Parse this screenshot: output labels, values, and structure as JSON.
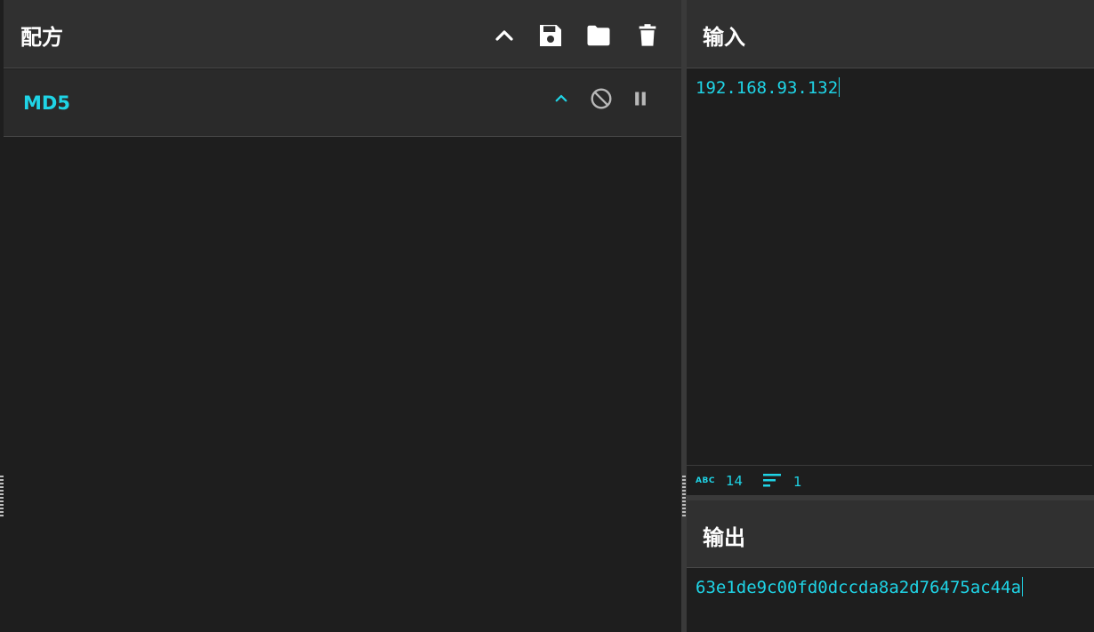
{
  "recipe": {
    "title": "配方",
    "toolbar": {
      "collapse_icon": "chevron-up-icon",
      "save_icon": "save-icon",
      "load_icon": "folder-icon",
      "clear_icon": "trash-icon"
    },
    "operations": [
      {
        "name": "MD5",
        "icons": [
          "chevron-up-icon",
          "disable-icon",
          "pause-icon"
        ]
      }
    ]
  },
  "input": {
    "title": "输入",
    "value": "192.168.93.132",
    "stats": {
      "length_label": "14",
      "lines_label": "1"
    }
  },
  "output": {
    "title": "输出",
    "value": "63e1de9c00fd0dccda8a2d76475ac44a"
  },
  "colors": {
    "accent": "#1fd4e6",
    "header_bg": "#303030",
    "pane_bg": "#1e1e1e",
    "op_bg": "#2a2a2a"
  }
}
